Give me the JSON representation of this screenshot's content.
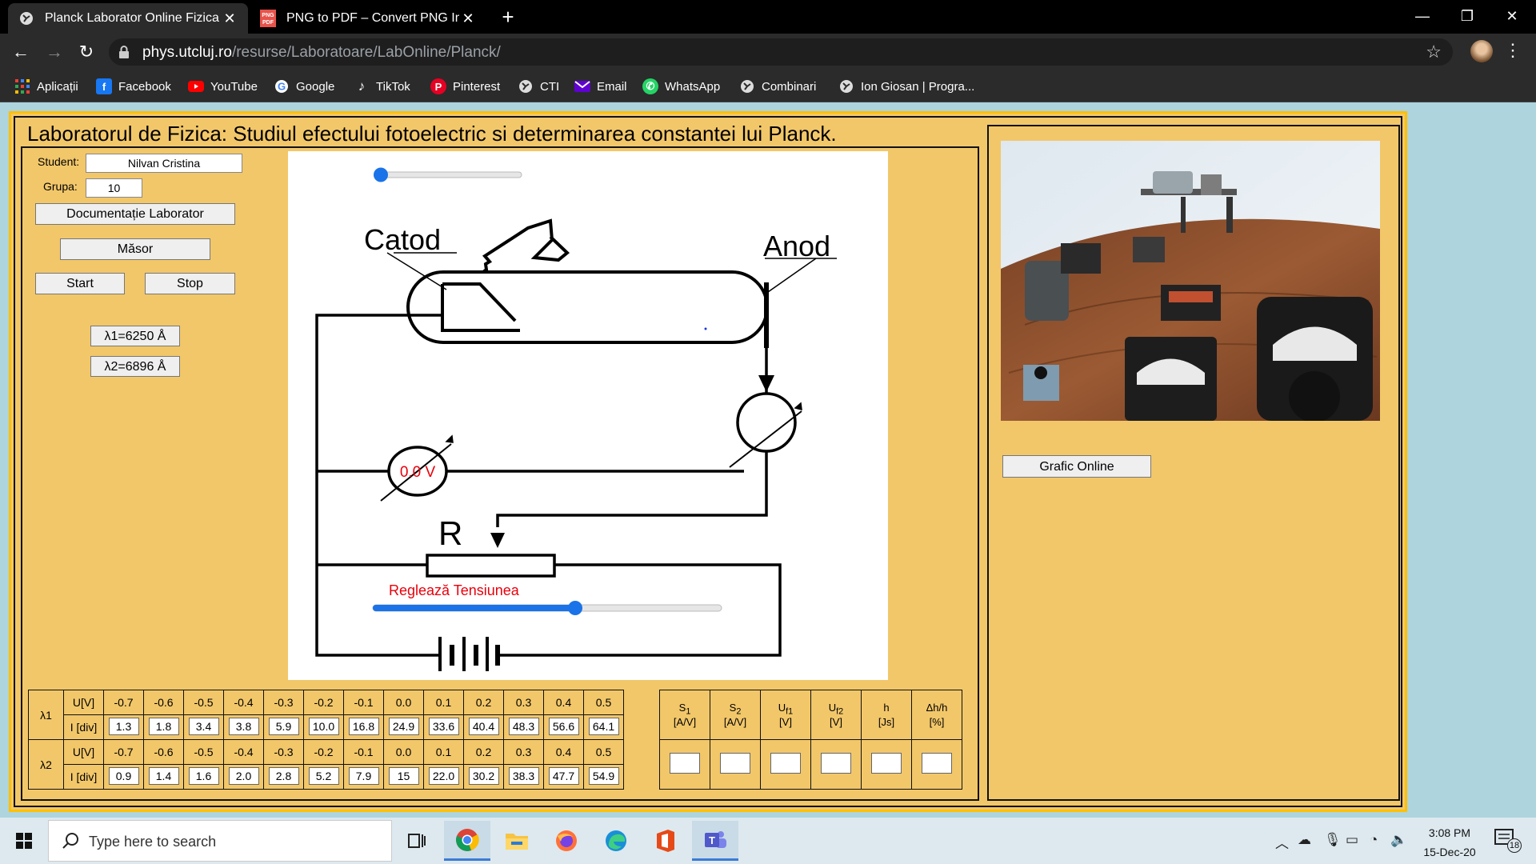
{
  "browser": {
    "tabs": [
      {
        "title": "Planck Laborator Online Fizica"
      },
      {
        "title": "PNG to PDF – Convert PNG Imag"
      }
    ],
    "url_domain": "phys.utcluj.ro",
    "url_path": "/resurse/Laboratoare/LabOnline/Planck/",
    "bookmarks": [
      {
        "label": "Aplicații",
        "icon": "apps-grid-icon"
      },
      {
        "label": "Facebook",
        "icon": "facebook-icon"
      },
      {
        "label": "YouTube",
        "icon": "youtube-icon"
      },
      {
        "label": "Google",
        "icon": "google-icon"
      },
      {
        "label": "TikTok",
        "icon": "tiktok-icon"
      },
      {
        "label": "Pinterest",
        "icon": "pinterest-icon"
      },
      {
        "label": "CTI",
        "icon": "globe-icon"
      },
      {
        "label": "Email",
        "icon": "yahoo-mail-icon"
      },
      {
        "label": "WhatsApp",
        "icon": "whatsapp-icon"
      },
      {
        "label": "Combinari",
        "icon": "globe-icon"
      },
      {
        "label": "Ion Giosan | Progra...",
        "icon": "globe-icon"
      }
    ]
  },
  "lab": {
    "title": "Laboratorul de Fizica: Studiul efectului fotoelectric si determinarea constantei lui Planck.",
    "student_label": "Student:",
    "student_value": "Nilvan Cristina",
    "group_label": "Grupa:",
    "group_value": "10",
    "doc_button": "Documentație Laborator",
    "masor_button": "Măsor",
    "start_button": "Start",
    "stop_button": "Stop",
    "lambda1_button": "λ1=6250 Å",
    "lambda2_button": "λ2=6896 Å",
    "grafic_button": "Grafic Online"
  },
  "circuit": {
    "cathode_label": "Catod",
    "anode_label": "Anod",
    "resistor_label": "R",
    "voltmeter_reading": "0.0 V",
    "voltage_slider_label": "Reglează Tensiunea",
    "top_slider_value": 0,
    "voltage_slider_value": 0.58
  },
  "measurements": {
    "lambda_labels": [
      "λ1",
      "λ2"
    ],
    "u_label": "U[V]",
    "i_label": "I [div]",
    "u_values": [
      "-0.7",
      "-0.6",
      "-0.5",
      "-0.4",
      "-0.3",
      "-0.2",
      "-0.1",
      "0.0",
      "0.1",
      "0.2",
      "0.3",
      "0.4",
      "0.5"
    ],
    "i_lambda1": [
      "1.3",
      "1.8",
      "3.4",
      "3.8",
      "5.9",
      "10.0",
      "16.8",
      "24.9",
      "33.6",
      "40.4",
      "48.3",
      "56.6",
      "64.1"
    ],
    "i_lambda2": [
      "0.9",
      "1.4",
      "1.6",
      "2.0",
      "2.8",
      "5.2",
      "7.9",
      "15",
      "22.0",
      "30.2",
      "38.3",
      "47.7",
      "54.9"
    ]
  },
  "results": {
    "headers": [
      {
        "sym": "S",
        "sub": "1",
        "unit": "[A/V]"
      },
      {
        "sym": "S",
        "sub": "2",
        "unit": "[A/V]"
      },
      {
        "sym": "U",
        "sub": "f1",
        "unit": "[V]"
      },
      {
        "sym": "U",
        "sub": "f2",
        "unit": "[V]"
      },
      {
        "sym": "h",
        "sub": "",
        "unit": "[Js]"
      },
      {
        "sym": "Δh/h",
        "sub": "",
        "unit": "[%]"
      }
    ]
  },
  "taskbar": {
    "search_placeholder": "Type here to search",
    "time": "3:08 PM",
    "date": "15-Dec-20",
    "notification_count": "18"
  }
}
